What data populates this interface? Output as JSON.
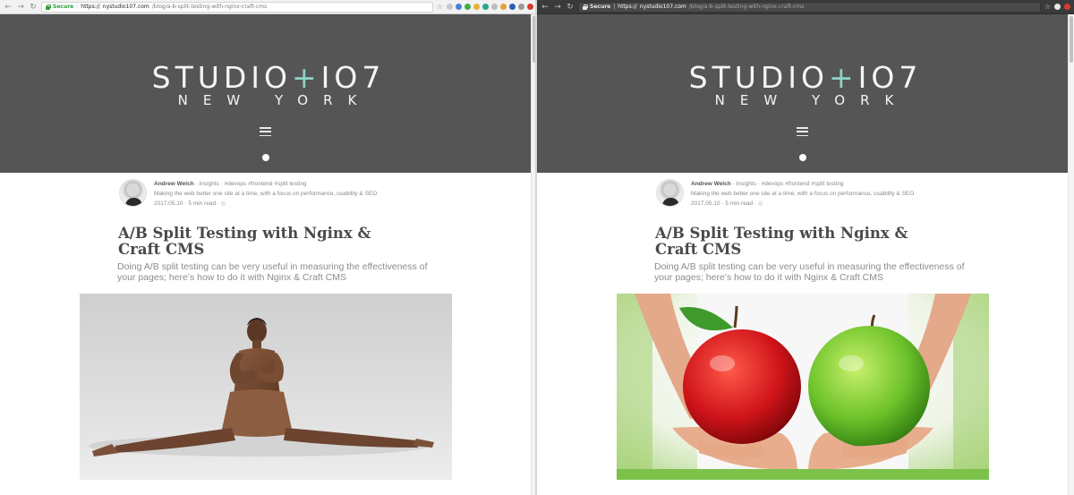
{
  "left_window": {
    "browser": {
      "secure_label": "Secure",
      "url_scheme": "https://",
      "url_host": "nystudio107.com",
      "url_path": "/blog/a-b-split-testing-with-nginx-craft-cms"
    },
    "header": {
      "logo_part1": "STUDIO",
      "logo_plus": "+",
      "logo_part2": "IO7",
      "logo_sub": "NEW YORK"
    },
    "article": {
      "author": "Andrew Welch",
      "category": "Insights",
      "tags": [
        "#devops",
        "#frontend",
        "#split testing"
      ],
      "bio": "Making the web better one site at a time, with a focus on performance, usability & SEO",
      "date": "2017.05.10",
      "read_time": "5 min read",
      "title": "A/B Split Testing with Nginx & Craft CMS",
      "subtitle": "Doing A/B split testing can be very useful in measuring the effectiveness of your pages; here’s how to do it with Nginx & Craft CMS"
    }
  },
  "right_window": {
    "browser": {
      "secure_label": "Secure",
      "url_scheme": "https://",
      "url_host": "nystudio107.com",
      "url_path": "/blog/a-b-split-testing-with-nginx-craft-cms"
    },
    "header": {
      "logo_part1": "STUDIO",
      "logo_plus": "+",
      "logo_part2": "IO7",
      "logo_sub": "NEW YORK"
    },
    "article": {
      "author": "Andrew Welch",
      "category": "Insights",
      "tags": [
        "#devops",
        "#frontend",
        "#split testing"
      ],
      "bio": "Making the web better one site at a time, with a focus on performance, usability & SEO",
      "date": "2017.05.10",
      "read_time": "5 min read",
      "title": "A/B Split Testing with Nginx & Craft CMS",
      "subtitle": "Doing A/B split testing can be very useful in measuring the effectiveness of your pages; here’s how to do it with Nginx & Craft CMS"
    }
  },
  "icons": {
    "back": "arrow-left-icon",
    "forward": "arrow-right-icon",
    "reload": "reload-icon",
    "lock": "lock-icon",
    "bookmark": "star-icon",
    "menu": "hamburger-menu-icon",
    "feed": "rss-icon"
  },
  "colors": {
    "header_bg": "#555556",
    "logo_accent": "#8fd3c7",
    "title_text": "#4a4a4a",
    "muted_text": "#8c8c8c",
    "secure_green": "#2e9d3a"
  }
}
